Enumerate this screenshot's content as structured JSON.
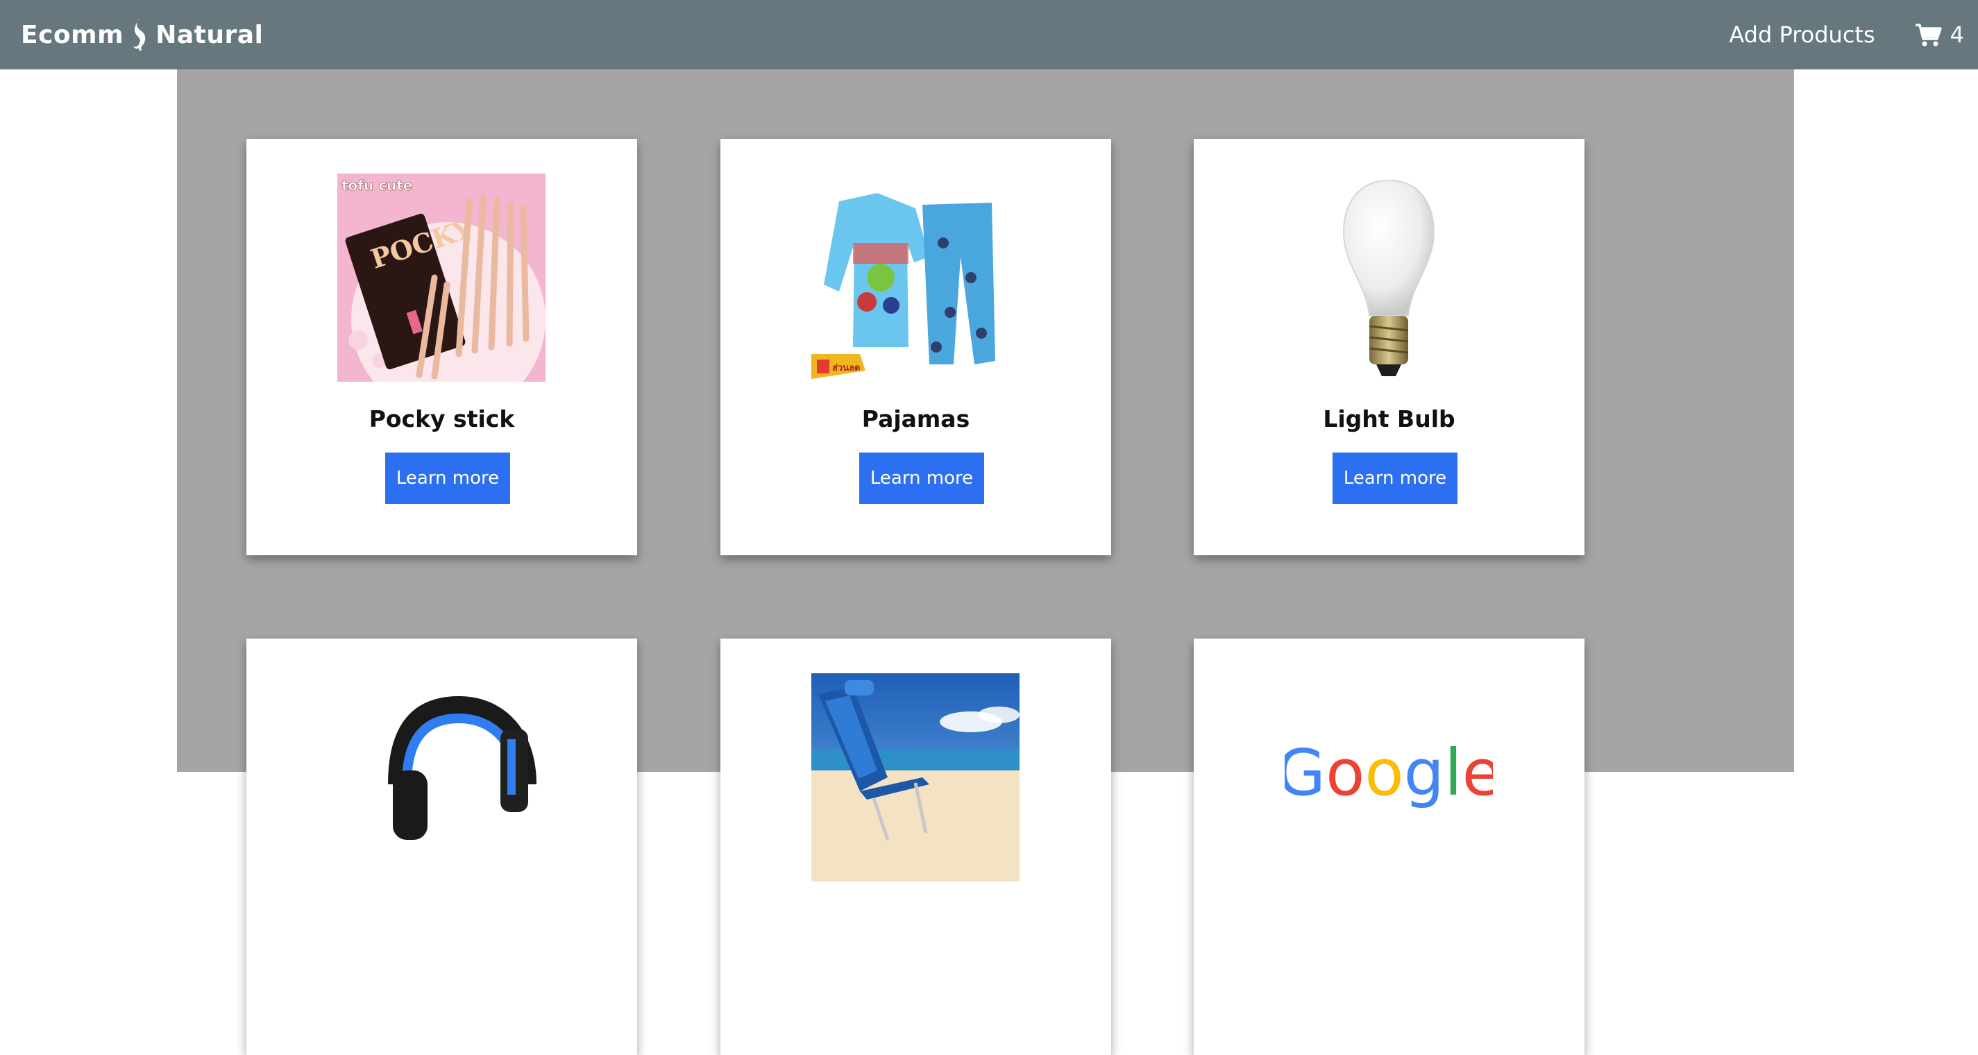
{
  "navbar": {
    "brand": "Ecomm",
    "brand_suffix": "Natural",
    "add_products": "Add Products",
    "cart_count": "4"
  },
  "products": [
    {
      "title": "Pocky stick",
      "button": "Learn more"
    },
    {
      "title": "Pajamas",
      "button": "Learn more"
    },
    {
      "title": "Light Bulb",
      "button": "Learn more"
    },
    {
      "title": "",
      "button": ""
    },
    {
      "title": "",
      "button": ""
    },
    {
      "title": "",
      "button": ""
    }
  ],
  "images": {
    "pocky": {
      "brand_text": "tofu cute",
      "product_text": "POCKY"
    },
    "pajama": {
      "badge_text": "ส่วนลด"
    },
    "google": {
      "text": "Google"
    }
  },
  "colors": {
    "navbar": "#66777e",
    "content_bg": "#a5a5a5",
    "button": "#2c6ff0"
  }
}
